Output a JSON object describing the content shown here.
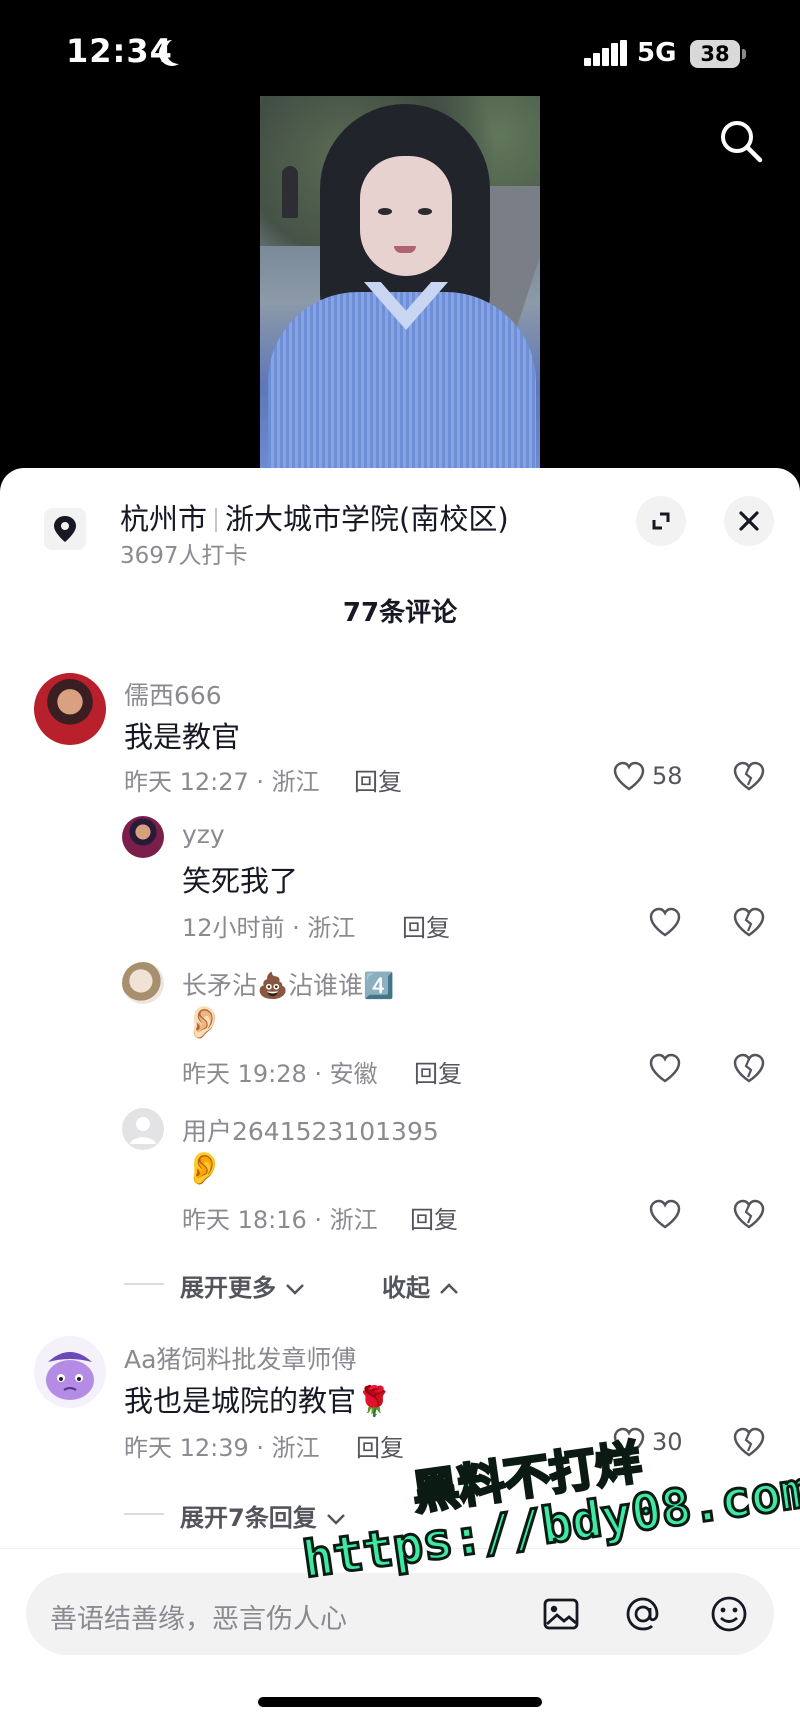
{
  "status_bar": {
    "time": "12:34",
    "network": "5G",
    "battery": "38"
  },
  "location": {
    "city": "杭州市",
    "place": "浙大城市学院(南校区)",
    "checkins": "3697人打卡"
  },
  "comments_header": "77条评论",
  "comments": [
    {
      "username": "儒西666",
      "text": "我是教官",
      "meta": "昨天 12:27 · 浙江",
      "reply_label": "回复",
      "likes": "58"
    },
    {
      "username": "yzy",
      "text": "笑死我了",
      "meta": "12小时前 · 浙江",
      "reply_label": "回复",
      "likes": ""
    },
    {
      "username": "长矛沾💩沾谁谁4️⃣",
      "text": "👂🏻",
      "meta": "昨天 19:28 · 安徽",
      "reply_label": "回复",
      "likes": ""
    },
    {
      "username": "用户2641523101395",
      "text": "👂",
      "meta": "昨天 18:16 · 浙江",
      "reply_label": "回复",
      "likes": ""
    },
    {
      "username": "Aa猪饲料批发章师傅",
      "text": "我也是城院的教官🌹",
      "meta": "昨天 12:39 · 浙江",
      "reply_label": "回复",
      "likes": "30"
    }
  ],
  "thread_controls": {
    "expand_more": "展开更多",
    "collapse": "收起",
    "expand_replies": "展开7条回复"
  },
  "input": {
    "placeholder": "善语结善缘，恶言伤人心"
  },
  "watermark": {
    "line1": "黑料不打烊",
    "line2": "https://bdy08.com"
  },
  "colors": {
    "accent_watermark": "#3ee9a4",
    "text_primary": "#161823",
    "text_secondary": "#8a8b91"
  }
}
